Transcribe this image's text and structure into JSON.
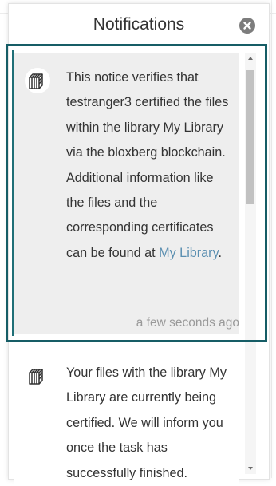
{
  "popup": {
    "title": "Notifications",
    "close_icon": "close-circle-icon"
  },
  "notifications": [
    {
      "icon": "blockchain-cube-icon",
      "text_before_link": "This notice verifies that testranger3 certified the files within the library My Library via the bloxberg blockchain. Additional information like the files and the corresponding certificates can be found at ",
      "link_text": "My Library",
      "text_after_link": ".",
      "time": "a few seconds ago"
    },
    {
      "icon": "blockchain-cube-icon",
      "text": "Your files with the library My Library are currently being certified. We will inform you once the task has successfully finished."
    }
  ],
  "colors": {
    "highlight_border": "#165d66",
    "link": "#5b8fb1",
    "selected_bg": "#eeeeee"
  }
}
